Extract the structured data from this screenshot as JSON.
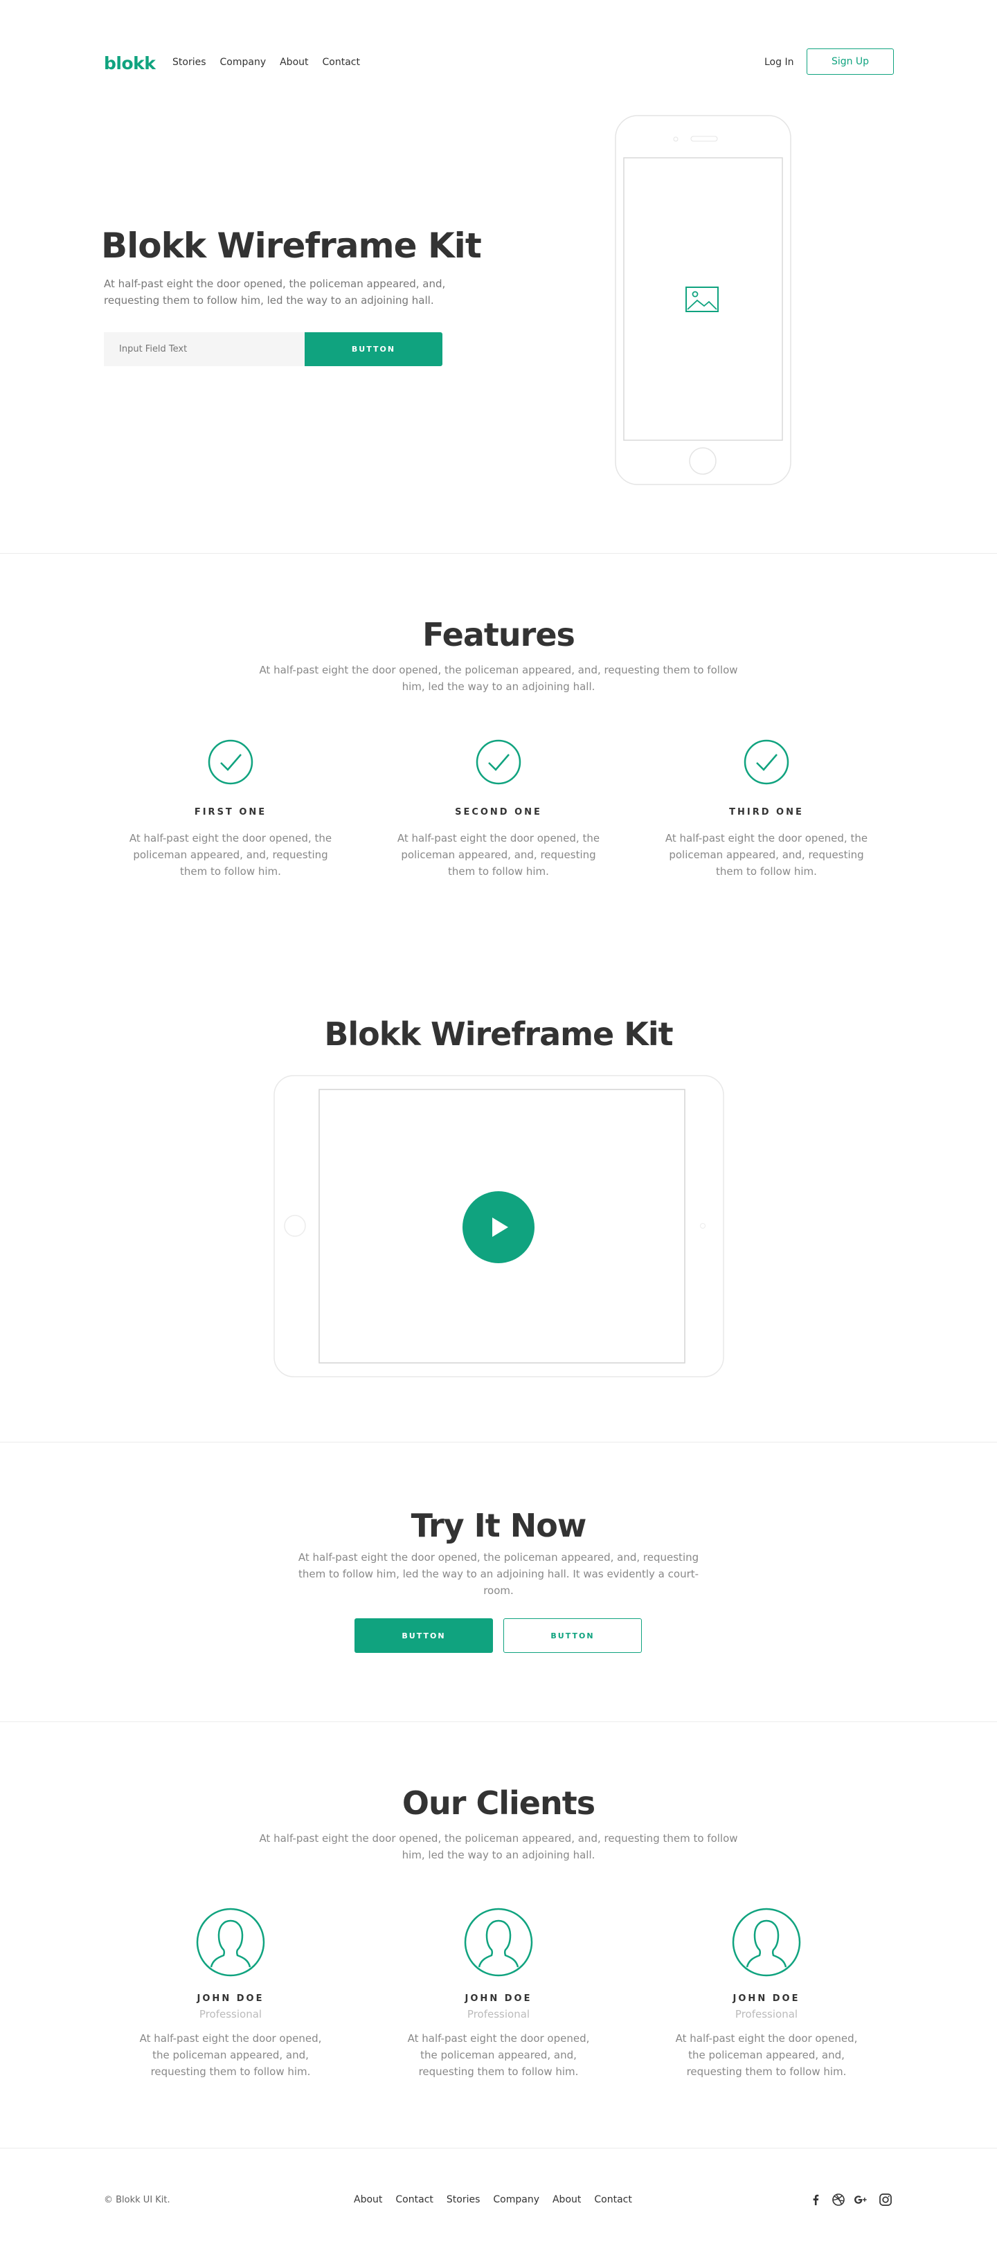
{
  "brand": {
    "logo": "blokk",
    "accent": "#10a37f"
  },
  "nav": {
    "links": [
      "Stories",
      "Company",
      "About",
      "Contact"
    ],
    "login": "Log In",
    "signup": "Sign Up"
  },
  "hero": {
    "title": "Blokk Wireframe Kit",
    "subtitle": "At half-past eight the door opened, the policeman appeared, and, requesting them to follow him, led the way to an adjoining hall.",
    "input_placeholder": "Input Field Text",
    "button": "BUTTON"
  },
  "features": {
    "title": "Features",
    "subtitle": "At half-past eight the door opened, the policeman appeared, and, requesting them to follow him, led the way to an adjoining hall.",
    "items": [
      {
        "title": "FIRST ONE",
        "text": "At half-past eight the door opened, the policeman appeared, and, requesting them to follow him."
      },
      {
        "title": "SECOND ONE",
        "text": "At half-past eight the door opened, the policeman appeared, and, requesting them to follow him."
      },
      {
        "title": "THIRD ONE",
        "text": "At half-past eight the door opened, the policeman appeared, and, requesting them to follow him."
      }
    ]
  },
  "video": {
    "title": "Blokk Wireframe Kit"
  },
  "try": {
    "title": "Try It Now",
    "subtitle": "At half-past eight the door opened, the policeman appeared, and, requesting them to follow him, led the way to an adjoining hall. It was evidently a court-room.",
    "primary_button": "BUTTON",
    "secondary_button": "BUTTON"
  },
  "clients": {
    "title": "Our Clients",
    "subtitle": "At half-past eight the door opened, the policeman appeared, and, requesting them to follow him, led the way to an adjoining hall.",
    "items": [
      {
        "name": "JOHN DOE",
        "role": "Professional",
        "text": "At half-past eight the door opened, the policeman appeared, and, requesting them to follow him."
      },
      {
        "name": "JOHN DOE",
        "role": "Professional",
        "text": "At half-past eight the door opened, the policeman appeared, and, requesting them to follow him."
      },
      {
        "name": "JOHN DOE",
        "role": "Professional",
        "text": "At half-past eight the door opened, the policeman appeared, and, requesting them to follow him."
      }
    ]
  },
  "footer": {
    "copyright": "© Blokk UI Kit.",
    "links": [
      "About",
      "Contact",
      "Stories",
      "Company",
      "About",
      "Contact"
    ],
    "social_icons": [
      "facebook-icon",
      "dribbble-icon",
      "google-plus-icon",
      "instagram-icon"
    ]
  }
}
